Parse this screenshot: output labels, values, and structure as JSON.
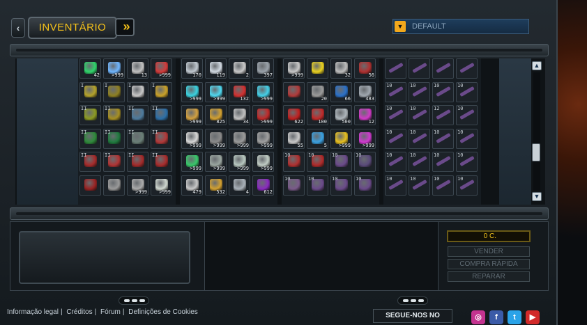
{
  "header": {
    "title": "INVENTÁRIO",
    "back_icon": "‹",
    "forward_icon": "»"
  },
  "preset": {
    "value": "DEFAULT"
  },
  "scrollbar": {
    "up": "▲",
    "down": "▼"
  },
  "inventory": {
    "columns": [
      {
        "rows": [
          [
            {
              "c": "#2fd46a",
              "q": "42"
            },
            {
              "c": "#6fb6ff",
              "q": ">999"
            },
            {
              "c": "#c0c0c0",
              "q": "13"
            },
            {
              "c": "#d23a3a",
              "q": ">999"
            }
          ],
          [
            {
              "c": "#b4a22a",
              "l": "I"
            },
            {
              "c": "#8d7f22",
              "l": "I"
            },
            {
              "c": "#c7c7c7",
              "l": "I"
            },
            {
              "c": "#c9a128",
              "l": "I"
            }
          ],
          [
            {
              "c": "#8c9a22",
              "l": "II"
            },
            {
              "c": "#a68f22",
              "l": "II"
            },
            {
              "c": "#4d7a9c",
              "l": "II"
            },
            {
              "c": "#2c6fa8",
              "l": "II"
            }
          ],
          [
            {
              "c": "#2e8a3a",
              "l": "II"
            },
            {
              "c": "#1f7a3e",
              "l": "II"
            },
            {
              "c": "#6a7f77",
              "l": "II"
            },
            {
              "c": "#b23838",
              "l": "II"
            }
          ],
          [
            {
              "c": "#a62a2a",
              "l": "II"
            },
            {
              "c": "#b03434",
              "l": "II"
            },
            {
              "c": "#a32a2a",
              "l": "II"
            },
            {
              "c": "#a82c2c",
              "l": "II"
            }
          ],
          [
            {
              "c": "#9a2222"
            },
            {
              "c": "#9a9a9a"
            },
            {
              "c": "#aaaaaa",
              "q": ">999"
            },
            {
              "c": "#d0d8d0",
              "q": ">999"
            }
          ]
        ]
      },
      {
        "rows": [
          [
            {
              "c": "#c0c8d0",
              "q": "170"
            },
            {
              "c": "#d0d8e0",
              "q": "119"
            },
            {
              "c": "#c8c8c8",
              "q": "2"
            },
            {
              "c": "#9aa2aa",
              "q": "397"
            }
          ],
          [
            {
              "c": "#3ad2e0",
              "q": ">999"
            },
            {
              "c": "#4fd8f0",
              "q": ">999"
            },
            {
              "c": "#d23030",
              "q": "132"
            },
            {
              "c": "#44d0e8",
              "q": ">999"
            }
          ],
          [
            {
              "c": "#d2a040",
              "q": ">999"
            },
            {
              "c": "#d2a030",
              "q": "825"
            },
            {
              "c": "#c0c0c0",
              "q": "34"
            },
            {
              "c": "#c02a2a",
              "q": ">999"
            }
          ],
          [
            {
              "c": "#d8d8d8",
              "q": ">999"
            },
            {
              "c": "#8a8a8a",
              "q": ">999"
            },
            {
              "c": "#9a9a9a",
              "q": ">999"
            },
            {
              "c": "#a0a0a0",
              "q": ">999"
            }
          ],
          [
            {
              "c": "#38c86a",
              "q": ">999"
            },
            {
              "c": "#9aa6a0",
              "q": ">999"
            },
            {
              "c": "#b8c8c0",
              "q": ">999"
            },
            {
              "c": "#c0ccc4",
              "q": ">999"
            }
          ],
          [
            {
              "c": "#c8c8c8",
              "q": "479"
            },
            {
              "c": "#d2a030",
              "q": "532"
            },
            {
              "c": "#a8b0b8",
              "q": "4"
            },
            {
              "c": "#8a2ac0",
              "q": "612"
            }
          ]
        ]
      },
      {
        "rows": [
          [
            {
              "c": "#c8c8c8",
              "q": ">999"
            },
            {
              "c": "#e8d020"
            },
            {
              "c": "#bdbdbd",
              "q": "32"
            },
            {
              "c": "#b03030",
              "q": "56"
            }
          ],
          [
            {
              "c": "#b03a3a"
            },
            {
              "c": "#9a9a9a",
              "q": "20"
            },
            {
              "c": "#2a70c8",
              "q": "66"
            },
            {
              "c": "#a0a8b0",
              "q": "483"
            }
          ],
          [
            {
              "c": "#c02020",
              "q": "622"
            },
            {
              "c": "#c02a2a",
              "q": "100"
            },
            {
              "c": "#aeb6bc",
              "q": "500"
            },
            {
              "c": "#d23ac8",
              "q": "12"
            }
          ],
          [
            {
              "c": "#c8c8c8",
              "q": "55"
            },
            {
              "c": "#3aa0e0",
              "q": "5"
            },
            {
              "c": "#e8c020",
              "q": ">999"
            },
            {
              "c": "#d03ad0",
              "q": ">999"
            }
          ],
          [
            {
              "c": "#b03030",
              "l": "10"
            },
            {
              "c": "#b02a2a",
              "l": "10"
            },
            {
              "c": "#6a4a8a",
              "l": "10"
            },
            {
              "c": "#5a4a7a",
              "l": "10"
            }
          ],
          [
            {
              "c": "#7a5a8a",
              "l": "10"
            },
            {
              "c": "#6a4a8a",
              "l": "10"
            },
            {
              "c": "#6a4a8a",
              "l": "10"
            },
            {
              "c": "#6a4a8a",
              "l": "10"
            }
          ]
        ]
      },
      {
        "rows": [
          [
            {
              "c": "#6a4a8a",
              "g": 1
            },
            {
              "c": "#6a4a8a",
              "g": 1
            },
            {
              "c": "#6a4a8a",
              "g": 1
            },
            {
              "c": "#6a4a8a",
              "g": 1
            }
          ],
          [
            {
              "c": "#6a4a8a",
              "l": "10",
              "g": 1
            },
            {
              "c": "#6a4a8a",
              "l": "10",
              "g": 1
            },
            {
              "c": "#6a4a8a",
              "l": "10",
              "g": 1
            },
            {
              "c": "#6a4a8a",
              "l": "10",
              "g": 1
            }
          ],
          [
            {
              "c": "#6a4a8a",
              "l": "10",
              "g": 1
            },
            {
              "c": "#6a4a8a",
              "l": "10",
              "g": 1
            },
            {
              "c": "#6a4a8a",
              "l": "12",
              "g": 1
            },
            {
              "c": "#6a4a8a",
              "l": "10",
              "g": 1
            }
          ],
          [
            {
              "c": "#6a4a8a",
              "l": "10",
              "g": 1
            },
            {
              "c": "#6a4a8a",
              "l": "10",
              "g": 1
            },
            {
              "c": "#6a4a8a",
              "l": "10",
              "g": 1
            },
            {
              "c": "#6a4a8a",
              "l": "10",
              "g": 1
            }
          ],
          [
            {
              "c": "#6a4a8a",
              "l": "10",
              "g": 1
            },
            {
              "c": "#6a4a8a",
              "l": "10",
              "g": 1
            },
            {
              "c": "#6a4a8a",
              "l": "10",
              "g": 1
            },
            {
              "c": "#6a4a8a",
              "l": "10",
              "g": 1
            }
          ],
          [
            {
              "c": "#6a4a8a",
              "l": "10",
              "g": 1
            },
            {
              "c": "#6a4a8a",
              "l": "10",
              "g": 1
            },
            {
              "c": "#6a4a8a",
              "l": "10",
              "g": 1
            },
            {
              "c": "#6a4a8a",
              "l": "10",
              "g": 1
            }
          ]
        ]
      }
    ]
  },
  "details": {
    "credits": "0 C.",
    "sell": "VENDER",
    "quick_buy": "COMPRA RÁPIDA",
    "repair": "REPARAR"
  },
  "footer": {
    "links": [
      "Informação legal",
      "Créditos",
      "Fórum",
      "Definições de Cookies"
    ],
    "separator": "|",
    "follow": "SEGUE-NOS NO",
    "social": [
      {
        "icon": "instagram-icon",
        "glyph": "◎",
        "color": "#c43390"
      },
      {
        "icon": "facebook-icon",
        "glyph": "f",
        "color": "#3b5ba8"
      },
      {
        "icon": "twitter-icon",
        "glyph": "t",
        "color": "#2aa3e8"
      },
      {
        "icon": "youtube-icon",
        "glyph": "▶",
        "color": "#d22a2a"
      }
    ]
  }
}
